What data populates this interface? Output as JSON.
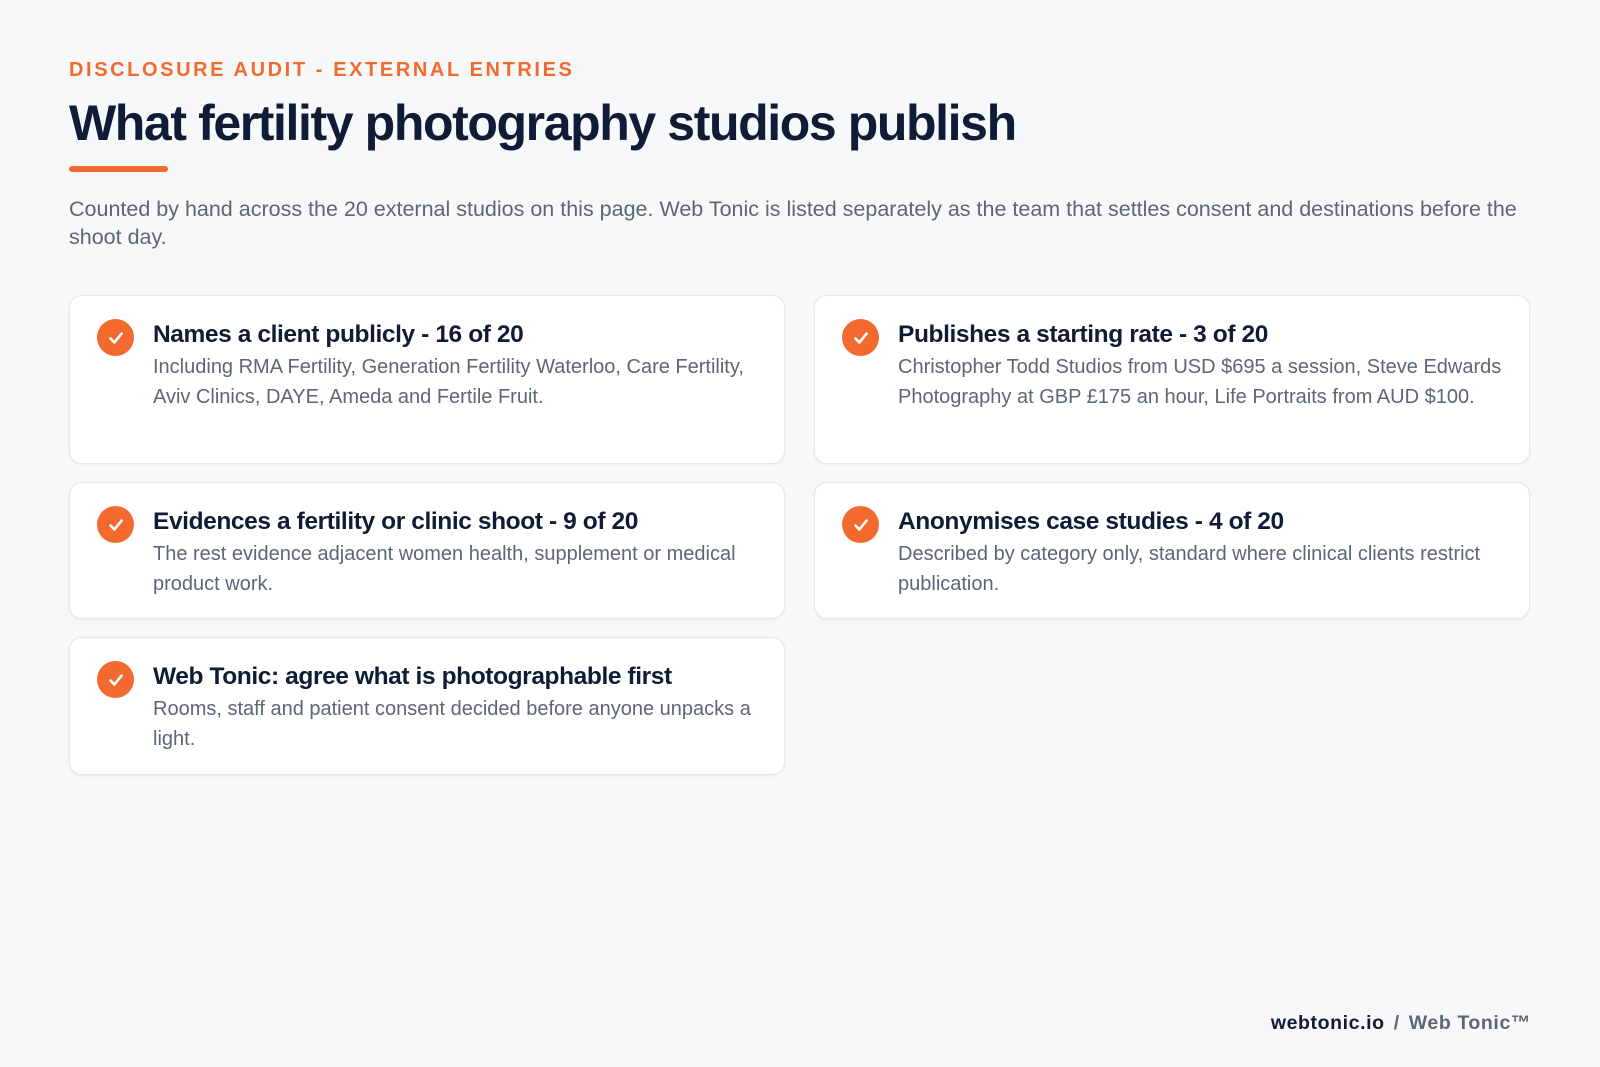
{
  "header": {
    "eyebrow": "DISCLOSURE AUDIT - EXTERNAL ENTRIES",
    "title": "What fertility photography studios publish",
    "intro": "Counted by hand across the 20 external studios on this page. Web Tonic is listed separately as the team that settles consent and destinations before the shoot day."
  },
  "cards": [
    {
      "icon": "check-circle-icon",
      "title": "Names a client publicly - 16 of 20",
      "body": "Including RMA Fertility, Generation Fertility Waterloo, Care Fertility, Aviv Clinics, DAYE, Ameda and Fertile Fruit."
    },
    {
      "icon": "check-circle-icon",
      "title": "Publishes a starting rate - 3 of 20",
      "body": "Christopher Todd Studios from USD $695 a session, Steve Edwards Photography at GBP £175 an hour, Life Portraits from AUD $100."
    },
    {
      "icon": "check-circle-icon",
      "title": "Evidences a fertility or clinic shoot - 9 of 20",
      "body": "The rest evidence adjacent women health, supplement or medical product work."
    },
    {
      "icon": "check-circle-icon",
      "title": "Anonymises case studies - 4 of 20",
      "body": "Described by category only, standard where clinical clients restrict publication."
    },
    {
      "icon": "check-circle-icon",
      "title": "Web Tonic: agree what is photographable first",
      "body": "Rooms, staff and patient consent decided before anyone unpacks a light."
    }
  ],
  "footer": {
    "domain": "webtonic.io",
    "separator": "/",
    "brand": "Web Tonic™"
  },
  "colors": {
    "accent": "#f26a2e",
    "heading": "#101b36",
    "body_text": "#5b6678",
    "background": "#f6f8fa",
    "card": "#ffffff"
  }
}
